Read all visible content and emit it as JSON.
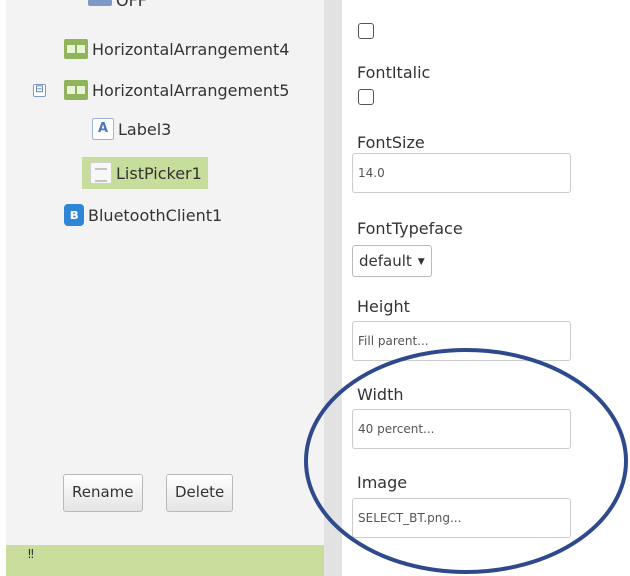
{
  "components": {
    "tree": [
      {
        "label": "OFF",
        "icon": "button-icon"
      },
      {
        "label": "HorizontalArrangement4",
        "icon": "horizontal-arrangement-icon"
      },
      {
        "label": "HorizontalArrangement5",
        "icon": "horizontal-arrangement-icon",
        "collapse": "⊟"
      },
      {
        "label": "Label3",
        "icon": "label-icon",
        "icon_glyph": "A"
      },
      {
        "label": "ListPicker1",
        "icon": "listpicker-icon",
        "selected": true
      },
      {
        "label": "BluetoothClient1",
        "icon": "bluetooth-icon",
        "icon_glyph": "ʙ"
      }
    ],
    "rename_label": "Rename",
    "delete_label": "Delete",
    "bottom_glyph": "‼"
  },
  "properties": {
    "fontitalic_label": "FontItalic",
    "fontsize_label": "FontSize",
    "fontsize_value": "14.0",
    "fonttypeface_label": "FontTypeface",
    "fonttypeface_value": "default",
    "fonttypeface_arrow": "▼",
    "height_label": "Height",
    "height_value": "Fill parent...",
    "width_label": "Width",
    "width_value": "40 percent...",
    "image_label": "Image",
    "image_value": "SELECT_BT.png..."
  },
  "colors": {
    "selected_row": "#c7dd9b",
    "arrangement_icon": "#8fb45b",
    "bluetooth_icon": "#2f86d6",
    "highlight_ellipse": "#2e4a8c"
  }
}
